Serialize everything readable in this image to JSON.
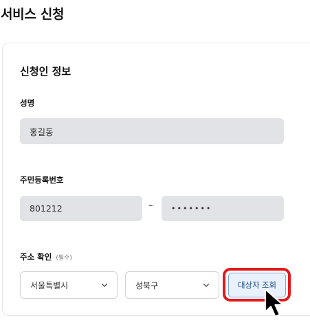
{
  "page": {
    "title": "서비스 신청"
  },
  "applicant_section": {
    "title": "신청인 정보",
    "name": {
      "label": "성명",
      "value": "홍길동"
    },
    "resident_number": {
      "label": "주민등록번호",
      "front": "801212",
      "separator": "–",
      "back_masked": "•••••••"
    },
    "address": {
      "label": "주소 확인",
      "required_note": "(필수)",
      "city": "서울특별시",
      "district": "성북구",
      "search_button_label": "대상자 조회"
    }
  },
  "colors": {
    "highlight_border": "#e3191c",
    "button_bg": "#e8f1fc",
    "button_text": "#1f4e8c",
    "readonly_field_bg": "#e1e3e6"
  },
  "icons": {
    "select_chevron": "chevron-down-icon",
    "cursor": "mouse-pointer-icon"
  }
}
